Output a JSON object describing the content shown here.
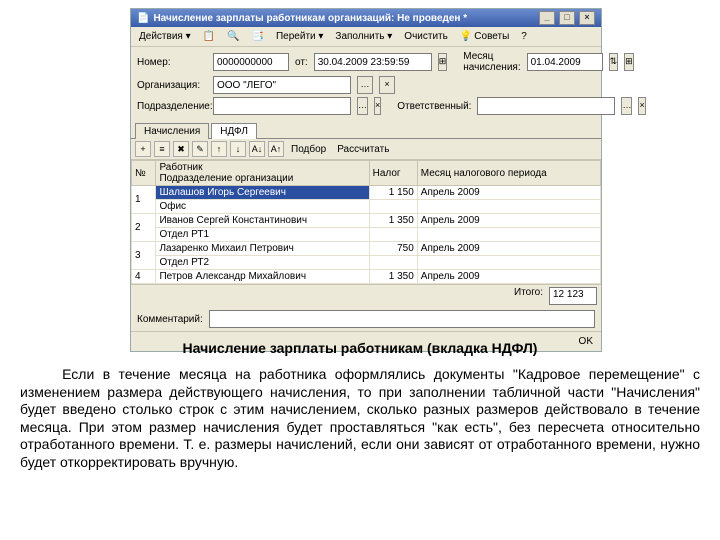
{
  "window": {
    "title": "Начисление зарплаты работникам организаций: Не проведен *"
  },
  "toolbar": {
    "actions": "Действия ▾",
    "go": "Перейти ▾",
    "fill": "Заполнить ▾",
    "clear": "Очистить",
    "advice": "Советы",
    "help": "?"
  },
  "form": {
    "number_label": "Номер:",
    "number": "0000000000",
    "from_label": "от:",
    "date": "30.04.2009 23:59:59",
    "month_label": "Месяц начисления:",
    "month": "01.04.2009",
    "org_label": "Организация:",
    "org": "ООО \"ЛЕГО\"",
    "subdiv_label": "Подразделение:",
    "resp_label": "Ответственный:"
  },
  "tabs": {
    "t1": "Начисления",
    "t2": "НДФЛ"
  },
  "gridbar": {
    "select": "Подбор",
    "calc": "Рассчитать"
  },
  "table": {
    "headers": {
      "n": "№",
      "emp": "Работник",
      "subdiv": "Подразделение организации",
      "tax": "Налог",
      "period": "Месяц налогового периода"
    },
    "rows": [
      {
        "n": "1",
        "emp": "Шалашов Игорь Сергеевич",
        "sub": "Офис",
        "tax": "1 150",
        "period": "Апрель 2009"
      },
      {
        "n": "2",
        "emp": "Иванов Сергей Константинович",
        "sub": "Отдел РТ1",
        "tax": "1 350",
        "period": "Апрель 2009"
      },
      {
        "n": "3",
        "emp": "Лазаренко Михаил Петрович",
        "sub": "Отдел РТ2",
        "tax": "750",
        "period": "Апрель 2009"
      },
      {
        "n": "4",
        "emp": "Петров Александр Михайлович",
        "sub": "",
        "tax": "1 350",
        "period": "Апрель 2009"
      }
    ],
    "total_label": "Итого:",
    "total": "12 123"
  },
  "comment_label": "Комментарий:",
  "doc": {
    "caption": "Начисление зарплаты работникам (вкладка НДФЛ)",
    "para": "Если в течение месяца на работника оформлялись документы \"Кадровое перемещение\" с изменением размера действующего начисления, то при заполнении табличной части \"Начисления\" будет введено столько строк с этим начислением, сколько разных размеров действовало в течение месяца. При этом размер начисления будет проставляться \"как есть\", без пересчета относительно отработанного времени. Т. е. размеры начислений, если они зависят от отработанного времени, нужно будет откорректировать вручную."
  }
}
